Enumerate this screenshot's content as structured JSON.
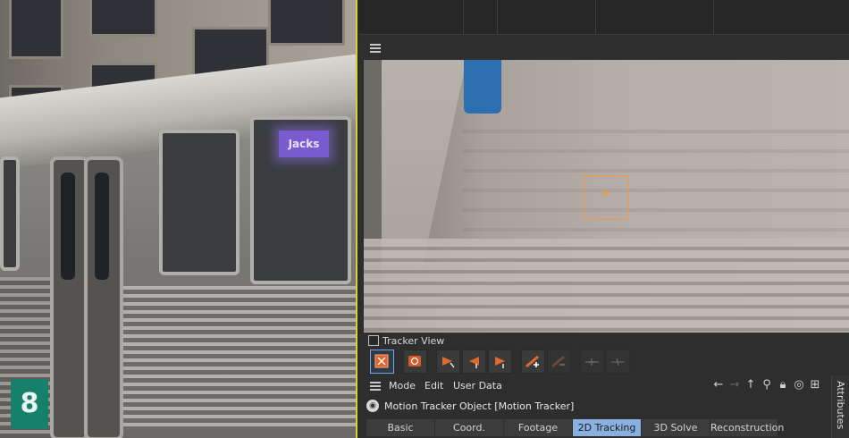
{
  "tracker_view": {
    "checkbox_label": "Tracker View",
    "checked": false
  },
  "photo": {
    "sign_text": "Jacks",
    "badge_text": "8"
  },
  "toolbar": {
    "tools": [
      {
        "name": "track-select-tool",
        "icon": "tracker-select-icon",
        "active": true
      },
      {
        "name": "auto-track-tool",
        "icon": "auto-track-icon",
        "active": false
      },
      {
        "name": "track-backward-step",
        "icon": "track-backward-icon",
        "active": false
      },
      {
        "name": "track-backward",
        "icon": "track-backward-all-icon",
        "active": false
      },
      {
        "name": "track-forward",
        "icon": "track-forward-icon",
        "active": false
      },
      {
        "name": "add-track",
        "icon": "add-track-icon",
        "active": false
      },
      {
        "name": "remove-track",
        "icon": "remove-track-icon",
        "disabled": true
      },
      {
        "name": "add-keyframe",
        "icon": "add-key-icon",
        "disabled": true
      },
      {
        "name": "remove-keyframe",
        "icon": "remove-key-icon",
        "disabled": true
      }
    ]
  },
  "menu": {
    "mode": "Mode",
    "edit": "Edit",
    "user_data": "User Data"
  },
  "object": {
    "title": "Motion Tracker Object [Motion Tracker]"
  },
  "tabs": [
    {
      "label": "Basic",
      "active": false
    },
    {
      "label": "Coord.",
      "active": false
    },
    {
      "label": "Footage",
      "active": false
    },
    {
      "label": "2D Tracking",
      "active": true
    },
    {
      "label": "3D Solve",
      "active": false
    },
    {
      "label": "Reconstruction",
      "active": false
    }
  ],
  "side_tab": {
    "label": "Attributes"
  },
  "colors": {
    "tracker_box": "#f09a3c",
    "active_tab": "#8ab0e0",
    "viewport_border": "#d8cf3a"
  }
}
